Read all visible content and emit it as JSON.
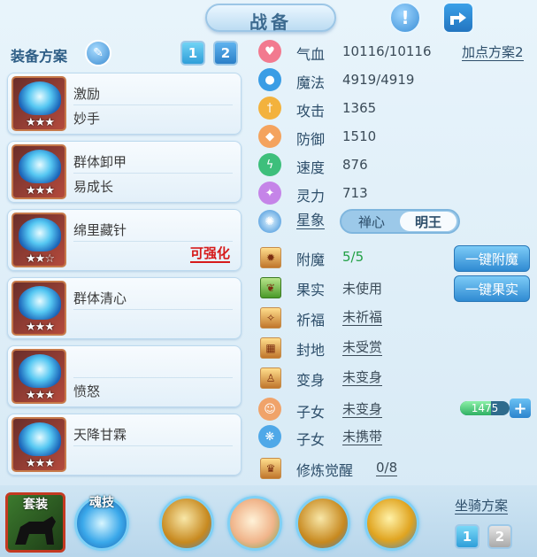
{
  "header": {
    "title": "战备",
    "info_icon": "exclamation-icon",
    "share_icon": "share-icon"
  },
  "equip_plan": {
    "title": "装备方案",
    "tabs": [
      "1",
      "2"
    ],
    "active_tab": "1",
    "items": [
      {
        "line1": "激励",
        "line2": "妙手",
        "stars": "★★★",
        "tag": ""
      },
      {
        "line1": "群体卸甲",
        "line2": "易成长",
        "stars": "★★★",
        "tag": ""
      },
      {
        "line1": "绵里藏针",
        "line2": "",
        "stars": "★★☆",
        "tag": "可强化"
      },
      {
        "line1": "群体清心",
        "line2": "",
        "stars": "★★★",
        "tag": ""
      },
      {
        "line1": "",
        "line2": "愤怒",
        "stars": "★★★",
        "tag": ""
      },
      {
        "line1": "天降甘霖",
        "line2": "",
        "stars": "★★★",
        "tag": ""
      }
    ]
  },
  "stats": {
    "point_plan": "加点方案2",
    "hp": {
      "label": "气血",
      "value": "10116/10116"
    },
    "mp": {
      "label": "魔法",
      "value": "4919/4919"
    },
    "atk": {
      "label": "攻击",
      "value": "1365"
    },
    "def": {
      "label": "防御",
      "value": "1510"
    },
    "spd": {
      "label": "速度",
      "value": "876"
    },
    "spirit": {
      "label": "灵力",
      "value": "713"
    },
    "star": {
      "label": "星象",
      "options": [
        "禅心",
        "明王"
      ],
      "selected": "明王"
    }
  },
  "extras": {
    "enchant": {
      "label": "附魔",
      "value": "5/5"
    },
    "fruit": {
      "label": "果实",
      "value": "未使用"
    },
    "pray": {
      "label": "祈福",
      "value": "未祈福"
    },
    "fief": {
      "label": "封地",
      "value": "未受赏"
    },
    "transform": {
      "label": "变身",
      "value": "未变身"
    },
    "child1": {
      "label": "子女",
      "value": "未变身"
    },
    "child2": {
      "label": "子女",
      "value": "未携带"
    },
    "awaken": {
      "label": "修炼觉醒",
      "value": "0/8"
    },
    "enchant_btn": "一键附魔",
    "fruit_btn": "一键果实",
    "child_slider": {
      "value": "1475",
      "fill": 0.62
    }
  },
  "bottom": {
    "tabs": [
      {
        "label": "套装"
      },
      {
        "label": "魂技"
      }
    ],
    "mount_plan": "坐骑方案",
    "mount_tabs": [
      "1",
      "2"
    ]
  },
  "colors": {
    "accent": "#2f8ad2",
    "strength_red": "#d61b1b",
    "green": "#21a045"
  }
}
